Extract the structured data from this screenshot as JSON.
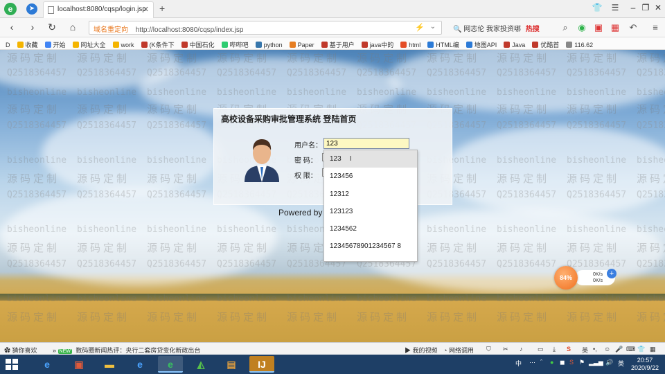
{
  "browser": {
    "tab_title": "localhost:8080/cqsp/login.jsp",
    "address": {
      "badge": "域名重定向",
      "url": "http://localhost:8080/cqsp/index.jsp"
    },
    "search": {
      "text": "网志伦 我家投资哪",
      "hot": "热搜"
    },
    "bookmarks": [
      {
        "label": "收藏",
        "color": "#f4b400"
      },
      {
        "label": "开始",
        "color": "#4285f4"
      },
      {
        "label": "网址大全",
        "color": "#f4b400"
      },
      {
        "label": "work",
        "color": "#f4b400"
      },
      {
        "label": "(K条件下",
        "color": "#c0392b"
      },
      {
        "label": "中国石化",
        "color": "#c0392b"
      },
      {
        "label": "哔哔吧",
        "color": "#2ecc71"
      },
      {
        "label": "python",
        "color": "#3776ab"
      },
      {
        "label": "Paper",
        "color": "#e67e22"
      },
      {
        "label": "基于用户",
        "color": "#c0392b"
      },
      {
        "label": "java中的",
        "color": "#c0392b"
      },
      {
        "label": "html",
        "color": "#e44d26"
      },
      {
        "label": "HTML编",
        "color": "#2c7ad6"
      },
      {
        "label": "地图API",
        "color": "#2c7ad6"
      },
      {
        "label": "Java",
        "color": "#c0392b"
      },
      {
        "label": "优酷首",
        "color": "#c0392b"
      },
      {
        "label": "116.62",
        "color": "#888888"
      }
    ]
  },
  "login": {
    "title": "高校设备采购审批管理系统 登陆首页",
    "username_label": "用户名：",
    "username_value": "123",
    "password_label": "密  码：",
    "role_label": "权  限：",
    "powered": "Powered by"
  },
  "autocomplete": {
    "options": [
      "123",
      "123456",
      "12312",
      "123123",
      "1234562",
      "12345678901234567 8"
    ],
    "selected_index": 0
  },
  "watermarks": {
    "site": "bisheonline",
    "brand": "源码定制",
    "qq": "Q2518364457"
  },
  "speed": {
    "percent": "84%",
    "up": "0K/s",
    "down": "0K/s"
  },
  "status": {
    "left_label": "猜你喜欢",
    "new_badge": "NEW",
    "news": "数码圈新闻热评：央行二套房贷变化新政出台",
    "download": "我的视频",
    "network": "网络调用"
  },
  "taskbar": {
    "time": "20:57",
    "date": "2020/9/22",
    "lang": "英",
    "input_lang": "中"
  }
}
